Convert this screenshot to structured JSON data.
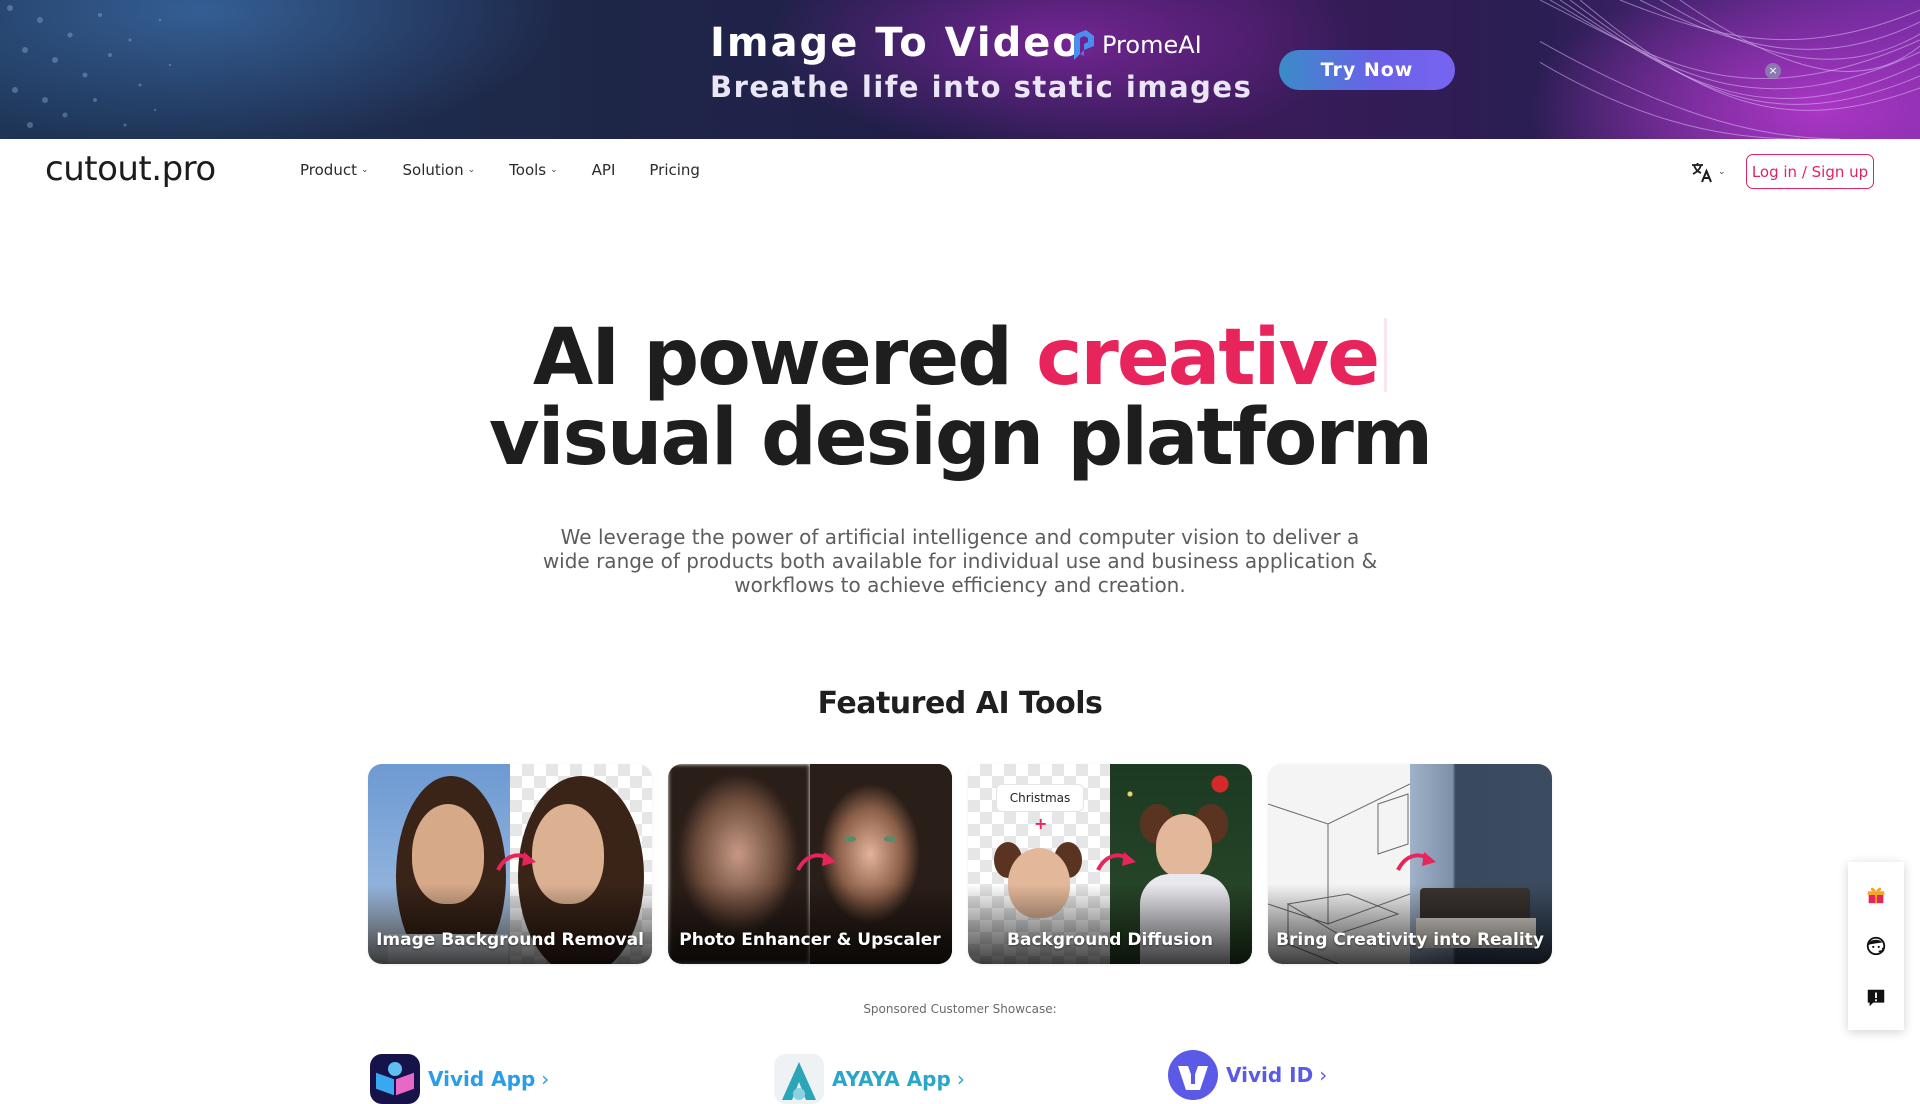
{
  "banner": {
    "title": "Image To Video",
    "subtitle": "Breathe life into static images",
    "brand": "PromeAI",
    "cta": "Try Now",
    "close_glyph": "×",
    "colors": {
      "cta_start": "#3a8cc8",
      "cta_end": "#7764f0"
    }
  },
  "nav": {
    "logo": "cutout.pro",
    "links": [
      {
        "label": "Product",
        "has_dropdown": true
      },
      {
        "label": "Solution",
        "has_dropdown": true
      },
      {
        "label": "Tools",
        "has_dropdown": true
      },
      {
        "label": "API",
        "has_dropdown": false
      },
      {
        "label": "Pricing",
        "has_dropdown": false
      }
    ],
    "chevron": "⌄",
    "language_icon": "translate-icon",
    "login_label": "Log in / Sign up",
    "accent": "#e0245e"
  },
  "hero": {
    "title_part1": "AI powered ",
    "title_accent": "creative",
    "title_line2": "visual design platform",
    "description": "We leverage the power of artificial intelligence and computer vision to deliver a wide range of products both available for individual use and business application & workflows to achieve efficiency and creation.",
    "accent_color": "#e8245c"
  },
  "featured": {
    "title": "Featured AI Tools",
    "cards": [
      {
        "label": "Image Background Removal"
      },
      {
        "label": "Photo Enhancer & Upscaler"
      },
      {
        "label": "Background Diffusion",
        "tag": "Christmas",
        "plus": "+"
      },
      {
        "label": "Bring Creativity into Reality"
      }
    ]
  },
  "showcase": {
    "heading": "Sponsored Customer Showcase:",
    "items": [
      {
        "name": "Vivid App",
        "arrow": "›",
        "color": "#2a9de6"
      },
      {
        "name": "AYAYA App",
        "arrow": "›",
        "color": "#2aa6c8"
      },
      {
        "name": "Vivid ID",
        "arrow": "›",
        "color": "#5a5ae6"
      }
    ]
  },
  "sidebar": {
    "buttons": [
      {
        "icon": "gift-icon"
      },
      {
        "icon": "customer-support-icon"
      },
      {
        "icon": "feedback-icon"
      }
    ]
  }
}
